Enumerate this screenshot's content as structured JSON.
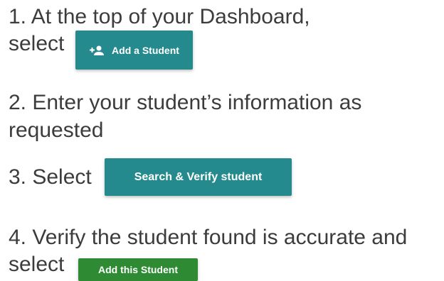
{
  "steps": {
    "step1_line1": "1. At the top of your Dashboard,",
    "step1_line2": "select",
    "step2_line1": "2. Enter your student’s information as",
    "step2_line2": "requested",
    "step3": "3. Select",
    "step4_line1": "4. Verify the student found is accurate and",
    "step4_line2": "select"
  },
  "buttons": {
    "add_student": "Add a Student",
    "add_student_icon": "add-person-icon",
    "search_verify": "Search & Verify student",
    "add_this_student": "Add this Student"
  },
  "colors": {
    "teal_button": "#258a8e",
    "green_button": "#2e8b34",
    "text": "#3c3c3c"
  }
}
